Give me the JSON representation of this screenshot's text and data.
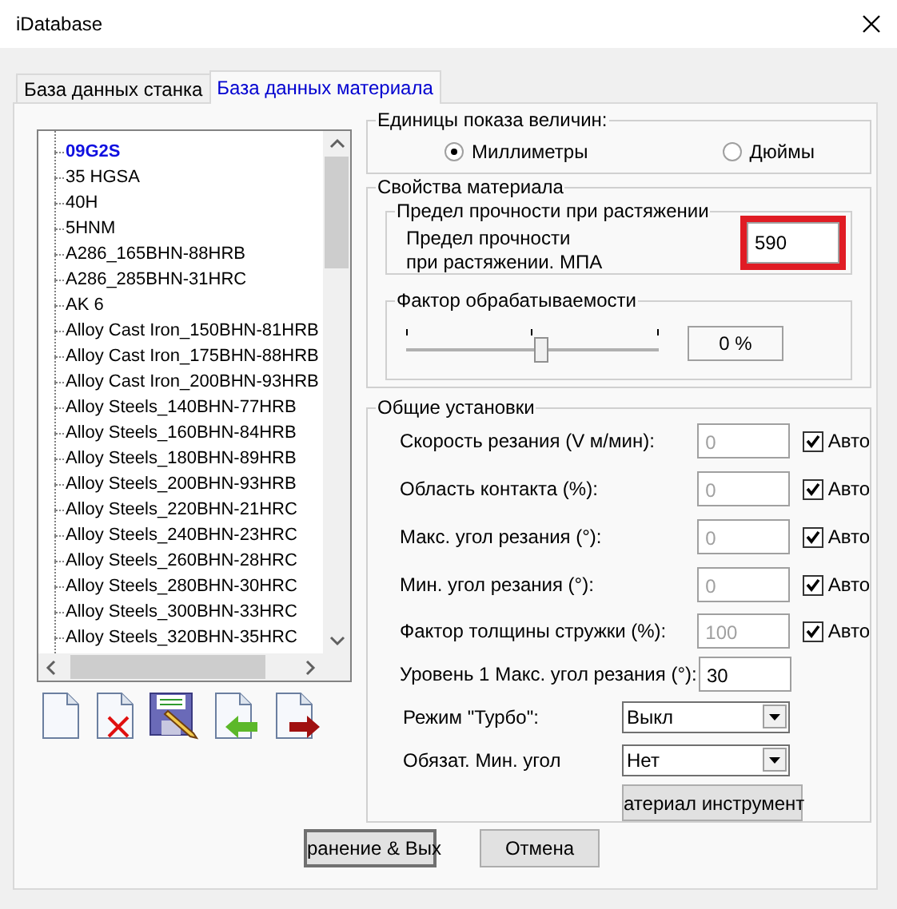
{
  "window": {
    "title": "iDatabase"
  },
  "tabs": [
    {
      "label": "База данных станка",
      "selected": false
    },
    {
      "label": "База данных материала",
      "selected": true
    }
  ],
  "materials": [
    {
      "label": "09G2S",
      "selected": true
    },
    {
      "label": "35 HGSA",
      "selected": false
    },
    {
      "label": "40H",
      "selected": false
    },
    {
      "label": "5HNM",
      "selected": false
    },
    {
      "label": "A286_165BHN-88HRB",
      "selected": false
    },
    {
      "label": "A286_285BHN-31HRC",
      "selected": false
    },
    {
      "label": "AK 6",
      "selected": false
    },
    {
      "label": "Alloy Cast Iron_150BHN-81HRB",
      "selected": false
    },
    {
      "label": "Alloy Cast Iron_175BHN-88HRB",
      "selected": false
    },
    {
      "label": "Alloy Cast Iron_200BHN-93HRB",
      "selected": false
    },
    {
      "label": "Alloy Steels_140BHN-77HRB",
      "selected": false
    },
    {
      "label": "Alloy Steels_160BHN-84HRB",
      "selected": false
    },
    {
      "label": "Alloy Steels_180BHN-89HRB",
      "selected": false
    },
    {
      "label": "Alloy Steels_200BHN-93HRB",
      "selected": false
    },
    {
      "label": "Alloy Steels_220BHN-21HRC",
      "selected": false
    },
    {
      "label": "Alloy Steels_240BHN-23HRC",
      "selected": false
    },
    {
      "label": "Alloy Steels_260BHN-28HRC",
      "selected": false
    },
    {
      "label": "Alloy Steels_280BHN-30HRC",
      "selected": false
    },
    {
      "label": "Alloy Steels_300BHN-33HRC",
      "selected": false
    },
    {
      "label": "Alloy Steels_320BHN-35HRC",
      "selected": false
    }
  ],
  "units": {
    "title": "Единицы показа величин:",
    "options": [
      {
        "label": "Миллиметры",
        "selected": true
      },
      {
        "label": "Дюймы",
        "selected": false
      }
    ]
  },
  "material_properties": {
    "title": "Свойства материала",
    "tensile_strength": {
      "title": "Предел прочности при растяжении",
      "label": "Предел прочности\nпри растяжении. МПА",
      "value": "590"
    },
    "machinability": {
      "title": "Фактор обрабатываемости",
      "level": 0.53,
      "reading": "0 %"
    }
  },
  "general": {
    "title": "Общие установки",
    "rows": [
      {
        "kind": "field",
        "label": "Скорость резания (V м/мин):",
        "value": "0",
        "disabled": true,
        "auto": {
          "label": "Авто",
          "checked": true
        }
      },
      {
        "kind": "field",
        "label": "Область контакта (%):",
        "value": "0",
        "disabled": true,
        "auto": {
          "label": "Авто",
          "checked": true
        }
      },
      {
        "kind": "field",
        "label": "Макс. угол резания (°):",
        "value": "0",
        "disabled": true,
        "auto": {
          "label": "Авто",
          "checked": true
        }
      },
      {
        "kind": "field",
        "label": "Мин. угол резания (°):",
        "value": "0",
        "disabled": true,
        "auto": {
          "label": "Авто",
          "checked": true
        }
      },
      {
        "kind": "field",
        "label": "Фактор толщины стружки (%):",
        "value": "100",
        "disabled": true,
        "auto": {
          "label": "Авто",
          "checked": true
        }
      },
      {
        "kind": "field",
        "label": "Уровень 1 Макс. угол резания (°):",
        "value": "30",
        "disabled": false
      },
      {
        "kind": "select",
        "label": "Режим \"Турбо\":",
        "value": "Выкл"
      },
      {
        "kind": "select",
        "label": "Обязат. Мин. угол",
        "value": "Нет"
      }
    ],
    "button": "атериал инструмент"
  },
  "buttons": [
    "ранение & Вых",
    "Отмена"
  ]
}
